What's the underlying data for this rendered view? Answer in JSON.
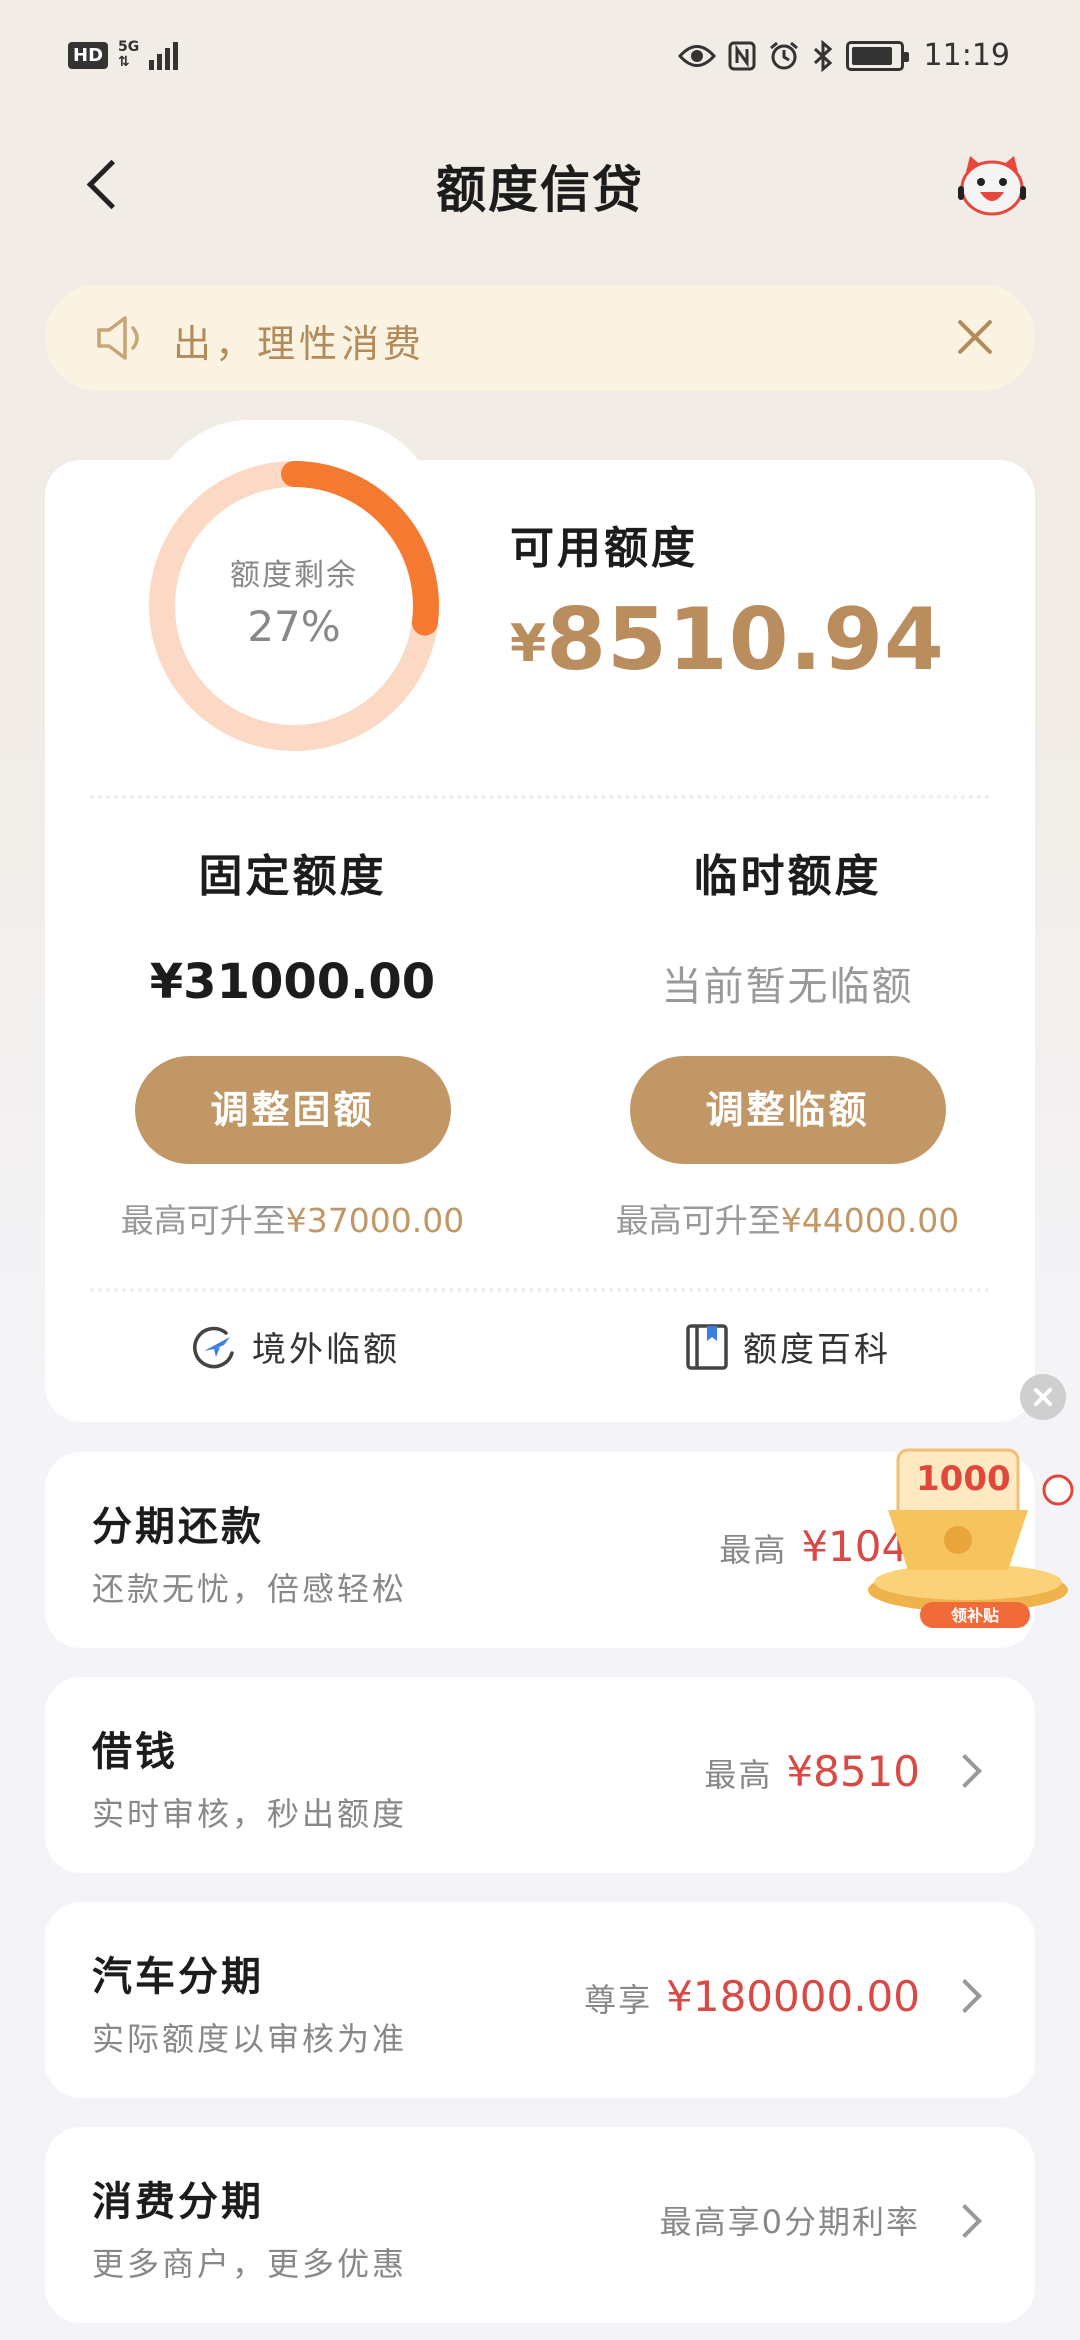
{
  "status_bar": {
    "hd": "HD",
    "network": "5G",
    "time": "11:19",
    "icons": [
      "eye-icon",
      "nfc-icon",
      "alarm-icon",
      "bluetooth-icon",
      "battery-icon"
    ]
  },
  "header": {
    "title": "额度信贷"
  },
  "notice": {
    "text": "出，理性消费"
  },
  "credit": {
    "ring_label": "额度剩余",
    "ring_percent_text": "27%",
    "remaining_fraction": 0.27,
    "available_label": "可用额度",
    "available_currency": "¥",
    "available_amount": "8510.94"
  },
  "fixed": {
    "title": "固定额度",
    "value": "¥31000.00",
    "button": "调整固额",
    "note_prefix": "最高可升至",
    "note_amount": "¥37000.00"
  },
  "temporary": {
    "title": "临时额度",
    "value": "当前暂无临额",
    "button": "调整临额",
    "note_prefix": "最高可升至",
    "note_amount": "¥44000.00"
  },
  "links": {
    "overseas": "境外临额",
    "wiki": "额度百科"
  },
  "products": [
    {
      "title": "分期还款",
      "subtitle": "还款无忧，倍感轻松",
      "prefix": "最高",
      "amount": "¥1043.0"
    },
    {
      "title": "借钱",
      "subtitle": "实时审核，秒出额度",
      "prefix": "最高",
      "amount": "¥8510"
    },
    {
      "title": "汽车分期",
      "subtitle": "实际额度以审核为准",
      "prefix": "尊享",
      "amount": "¥180000.00"
    },
    {
      "title": "消费分期",
      "subtitle": "更多商户，更多优惠",
      "prefix": "最高享0分期利率",
      "amount": ""
    }
  ],
  "promo": {
    "amount": "1000",
    "label": "领补贴"
  },
  "colors": {
    "gold": "#c29766",
    "ring_track": "#fbd9c4",
    "ring_fill": "#f47a32",
    "price_red": "#d84a45",
    "notice_bg": "#fbf3e2"
  }
}
